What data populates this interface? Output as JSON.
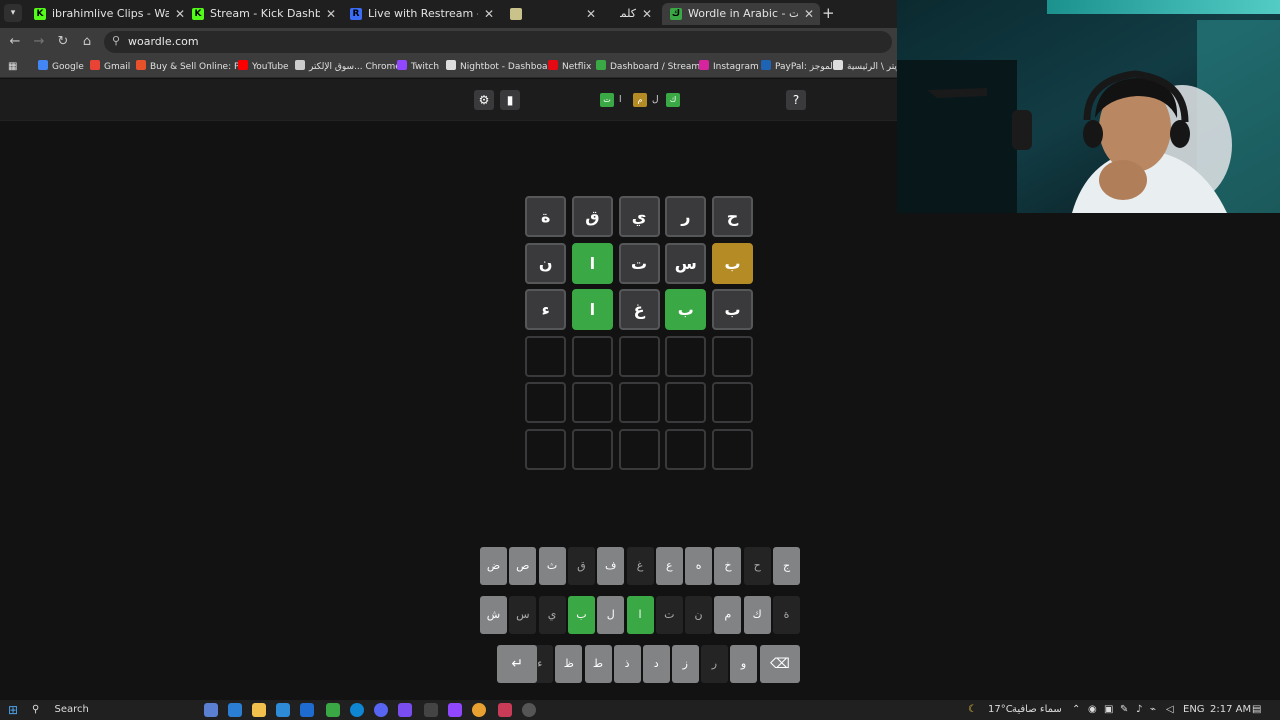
{
  "browser": {
    "tabs": [
      {
        "title": "ibrahimlive Clips - Watch Live o",
        "favicon": "kick-icon",
        "color": "#53fc18",
        "letter": "K"
      },
      {
        "title": "Stream - Kick Dashboard",
        "favicon": "kick-icon",
        "color": "#53fc18",
        "letter": "K"
      },
      {
        "title": "Live with Restream - Restream",
        "favicon": "restream-icon",
        "color": "#3b6cf6",
        "letter": "R"
      },
      {
        "title": "",
        "favicon": "generic-page-icon",
        "color": "#c9c28a",
        "letter": ""
      },
      {
        "title": "كلمة",
        "favicon": "",
        "color": "",
        "letter": ""
      },
      {
        "title": "Wordle in Arabic - كلمات",
        "favicon": "woardle-icon",
        "color": "#3aa845",
        "letter": "ك"
      }
    ],
    "new_tab": "+",
    "url": "woardle.com",
    "bookmarks": [
      {
        "label": "Google",
        "color": "#4285f4"
      },
      {
        "label": "Gmail",
        "color": "#ea4335"
      },
      {
        "label": "Buy & Sell Online: P...",
        "color": "#e8512a"
      },
      {
        "label": "YouTube",
        "color": "#ff0000"
      },
      {
        "label": "سوق الإلكتر... Chrome",
        "color": "#cccccc"
      },
      {
        "label": "Twitch",
        "color": "#9146ff"
      },
      {
        "label": "Nightbot - Dashboa...",
        "color": "#dddddd"
      },
      {
        "label": "Netflix",
        "color": "#e50914"
      },
      {
        "label": "Dashboard / Stream...",
        "color": "#3aa845"
      },
      {
        "label": "Instagram",
        "color": "#d6249f"
      },
      {
        "label": "PayPal: الموجز",
        "color": "#1f64b4"
      },
      {
        "label": "تويتر \\ الرئيسية",
        "color": "#dddddd"
      }
    ]
  },
  "game": {
    "header": {
      "settings_icon": "gear-icon",
      "stats_icon": "bar-chart-icon",
      "help_label": "?",
      "logo_tiles": [
        {
          "char": "ت",
          "state": "green"
        },
        {
          "char": "ا",
          "state": "none"
        },
        {
          "char": "م",
          "state": "yellow"
        },
        {
          "char": "ل",
          "state": "none"
        },
        {
          "char": "ك",
          "state": "green"
        }
      ]
    },
    "board": [
      [
        {
          "c": "ح",
          "s": "filled"
        },
        {
          "c": "ر",
          "s": "filled"
        },
        {
          "c": "ي",
          "s": "filled"
        },
        {
          "c": "ق",
          "s": "filled"
        },
        {
          "c": "ة",
          "s": "filled"
        }
      ],
      [
        {
          "c": "ب",
          "s": "yellow"
        },
        {
          "c": "س",
          "s": "filled"
        },
        {
          "c": "ت",
          "s": "filled"
        },
        {
          "c": "ا",
          "s": "green"
        },
        {
          "c": "ن",
          "s": "filled"
        }
      ],
      [
        {
          "c": "ب",
          "s": "filled"
        },
        {
          "c": "ب",
          "s": "green"
        },
        {
          "c": "غ",
          "s": "filled"
        },
        {
          "c": "ا",
          "s": "green"
        },
        {
          "c": "ء",
          "s": "filled"
        }
      ],
      [
        {
          "c": "",
          "s": "empty"
        },
        {
          "c": "",
          "s": "empty"
        },
        {
          "c": "",
          "s": "empty"
        },
        {
          "c": "",
          "s": "empty"
        },
        {
          "c": "",
          "s": "empty"
        }
      ],
      [
        {
          "c": "",
          "s": "empty"
        },
        {
          "c": "",
          "s": "empty"
        },
        {
          "c": "",
          "s": "empty"
        },
        {
          "c": "",
          "s": "empty"
        },
        {
          "c": "",
          "s": "empty"
        }
      ],
      [
        {
          "c": "",
          "s": "empty"
        },
        {
          "c": "",
          "s": "empty"
        },
        {
          "c": "",
          "s": "empty"
        },
        {
          "c": "",
          "s": "empty"
        },
        {
          "c": "",
          "s": "empty"
        }
      ]
    ],
    "keyboard": [
      [
        {
          "k": "ج",
          "s": "dark"
        },
        {
          "k": "ح",
          "s": "used"
        },
        {
          "k": "خ",
          "s": "dark"
        },
        {
          "k": "ه",
          "s": "dark"
        },
        {
          "k": "ع",
          "s": "dark"
        },
        {
          "k": "غ",
          "s": "used"
        },
        {
          "k": "ف",
          "s": "dark"
        },
        {
          "k": "ق",
          "s": "used"
        },
        {
          "k": "ث",
          "s": "dark"
        },
        {
          "k": "ص",
          "s": "dark"
        },
        {
          "k": "ض",
          "s": "dark"
        }
      ],
      [
        {
          "k": "ة",
          "s": "used"
        },
        {
          "k": "ك",
          "s": "dark"
        },
        {
          "k": "م",
          "s": "dark"
        },
        {
          "k": "ن",
          "s": "used"
        },
        {
          "k": "ت",
          "s": "used"
        },
        {
          "k": "ا",
          "s": "green"
        },
        {
          "k": "ل",
          "s": "dark"
        },
        {
          "k": "ب",
          "s": "green"
        },
        {
          "k": "ي",
          "s": "used"
        },
        {
          "k": "س",
          "s": "used"
        },
        {
          "k": "ش",
          "s": "dark"
        }
      ],
      [
        {
          "k": "⌫",
          "s": "wide"
        },
        {
          "k": "و",
          "s": "dark"
        },
        {
          "k": "ر",
          "s": "used"
        },
        {
          "k": "ز",
          "s": "dark"
        },
        {
          "k": "د",
          "s": "dark"
        },
        {
          "k": "ذ",
          "s": "dark"
        },
        {
          "k": "ط",
          "s": "dark"
        },
        {
          "k": "ظ",
          "s": "dark"
        },
        {
          "k": "ء",
          "s": "used"
        },
        {
          "k": "↵",
          "s": "wide"
        }
      ]
    ]
  },
  "taskbar": {
    "search_label": "Search",
    "weather_temp": "17°C",
    "weather_text": "سماء صافية",
    "language": "ENG",
    "time": "2:17 AM"
  },
  "colors": {
    "correct": "#3aa845",
    "present": "#b58b25",
    "absent_tile": "#3a3a3c"
  }
}
